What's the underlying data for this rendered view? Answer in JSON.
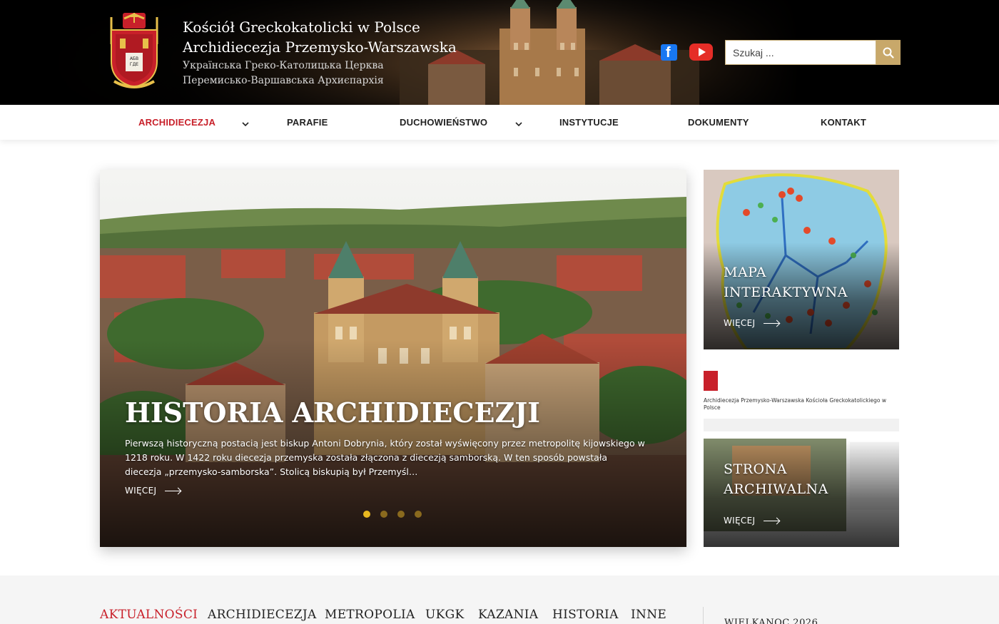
{
  "header": {
    "title_line1": "Kościół Greckokatolicki w Polsce",
    "title_line2": "Archidiecezja Przemysko-Warszawska",
    "subtitle_line1": "Українська Греко-Католицька Церква",
    "subtitle_line2": "Перемисько-Варшавська Архиєпархія",
    "search_placeholder": "Szukaj ..."
  },
  "nav": {
    "items": [
      {
        "label": "ARCHIDIECEZJA",
        "active": true,
        "has_dropdown": true
      },
      {
        "label": "PARAFIE",
        "active": false,
        "has_dropdown": false
      },
      {
        "label": "DUCHOWIEŃSTWO",
        "active": false,
        "has_dropdown": true
      },
      {
        "label": "INSTYTUCJE",
        "active": false,
        "has_dropdown": false
      },
      {
        "label": "DOKUMENTY",
        "active": false,
        "has_dropdown": false
      },
      {
        "label": "KONTAKT",
        "active": false,
        "has_dropdown": false
      }
    ]
  },
  "slider": {
    "title": "HISTORIA ARCHIDIECEZJI",
    "text": "Pierwszą historyczną postacią jest biskup Antoni Dobrynia, który został wyświęcony przez metropolitę kijowskiego w 1218 roku. W 1422 roku diecezja przemyska została złączona z diecezją samborską. W ten sposób powstała diecezja „przemysko-samborska”. Stolicą biskupią był Przemyśl…",
    "more_label": "WIĘCEJ",
    "slide_count": 4,
    "active_slide": 1
  },
  "cards": [
    {
      "title_line1": "MAPA",
      "title_line2": "INTERAKTYWNA",
      "more_label": "WIĘCEJ"
    },
    {
      "title_line1": "STRONA",
      "title_line2": "ARCHIWALNA",
      "more_label": "WIĘCEJ",
      "preview_heading": "Archidiecezja Przemysko-Warszawska Kościoła Greckokatolickiego w Polsce"
    }
  ],
  "tabs": [
    "AKTUALNOŚCI",
    "ARCHIDIECEZJA",
    "METROPOLIA",
    "UKGK",
    "KAZANIA",
    "HISTORIA",
    "INNE"
  ],
  "active_tab": 0,
  "sidebar_heading": "WIELKANOC 2026",
  "colors": {
    "accent_red": "#c8202a",
    "gold": "#c8a86a",
    "dot_active": "#e8b820",
    "dot_inactive": "#8a6a1e"
  },
  "icons": [
    "facebook-icon",
    "youtube-icon",
    "search-icon",
    "chevron-down-icon",
    "arrow-right-icon",
    "coat-of-arms-logo"
  ]
}
